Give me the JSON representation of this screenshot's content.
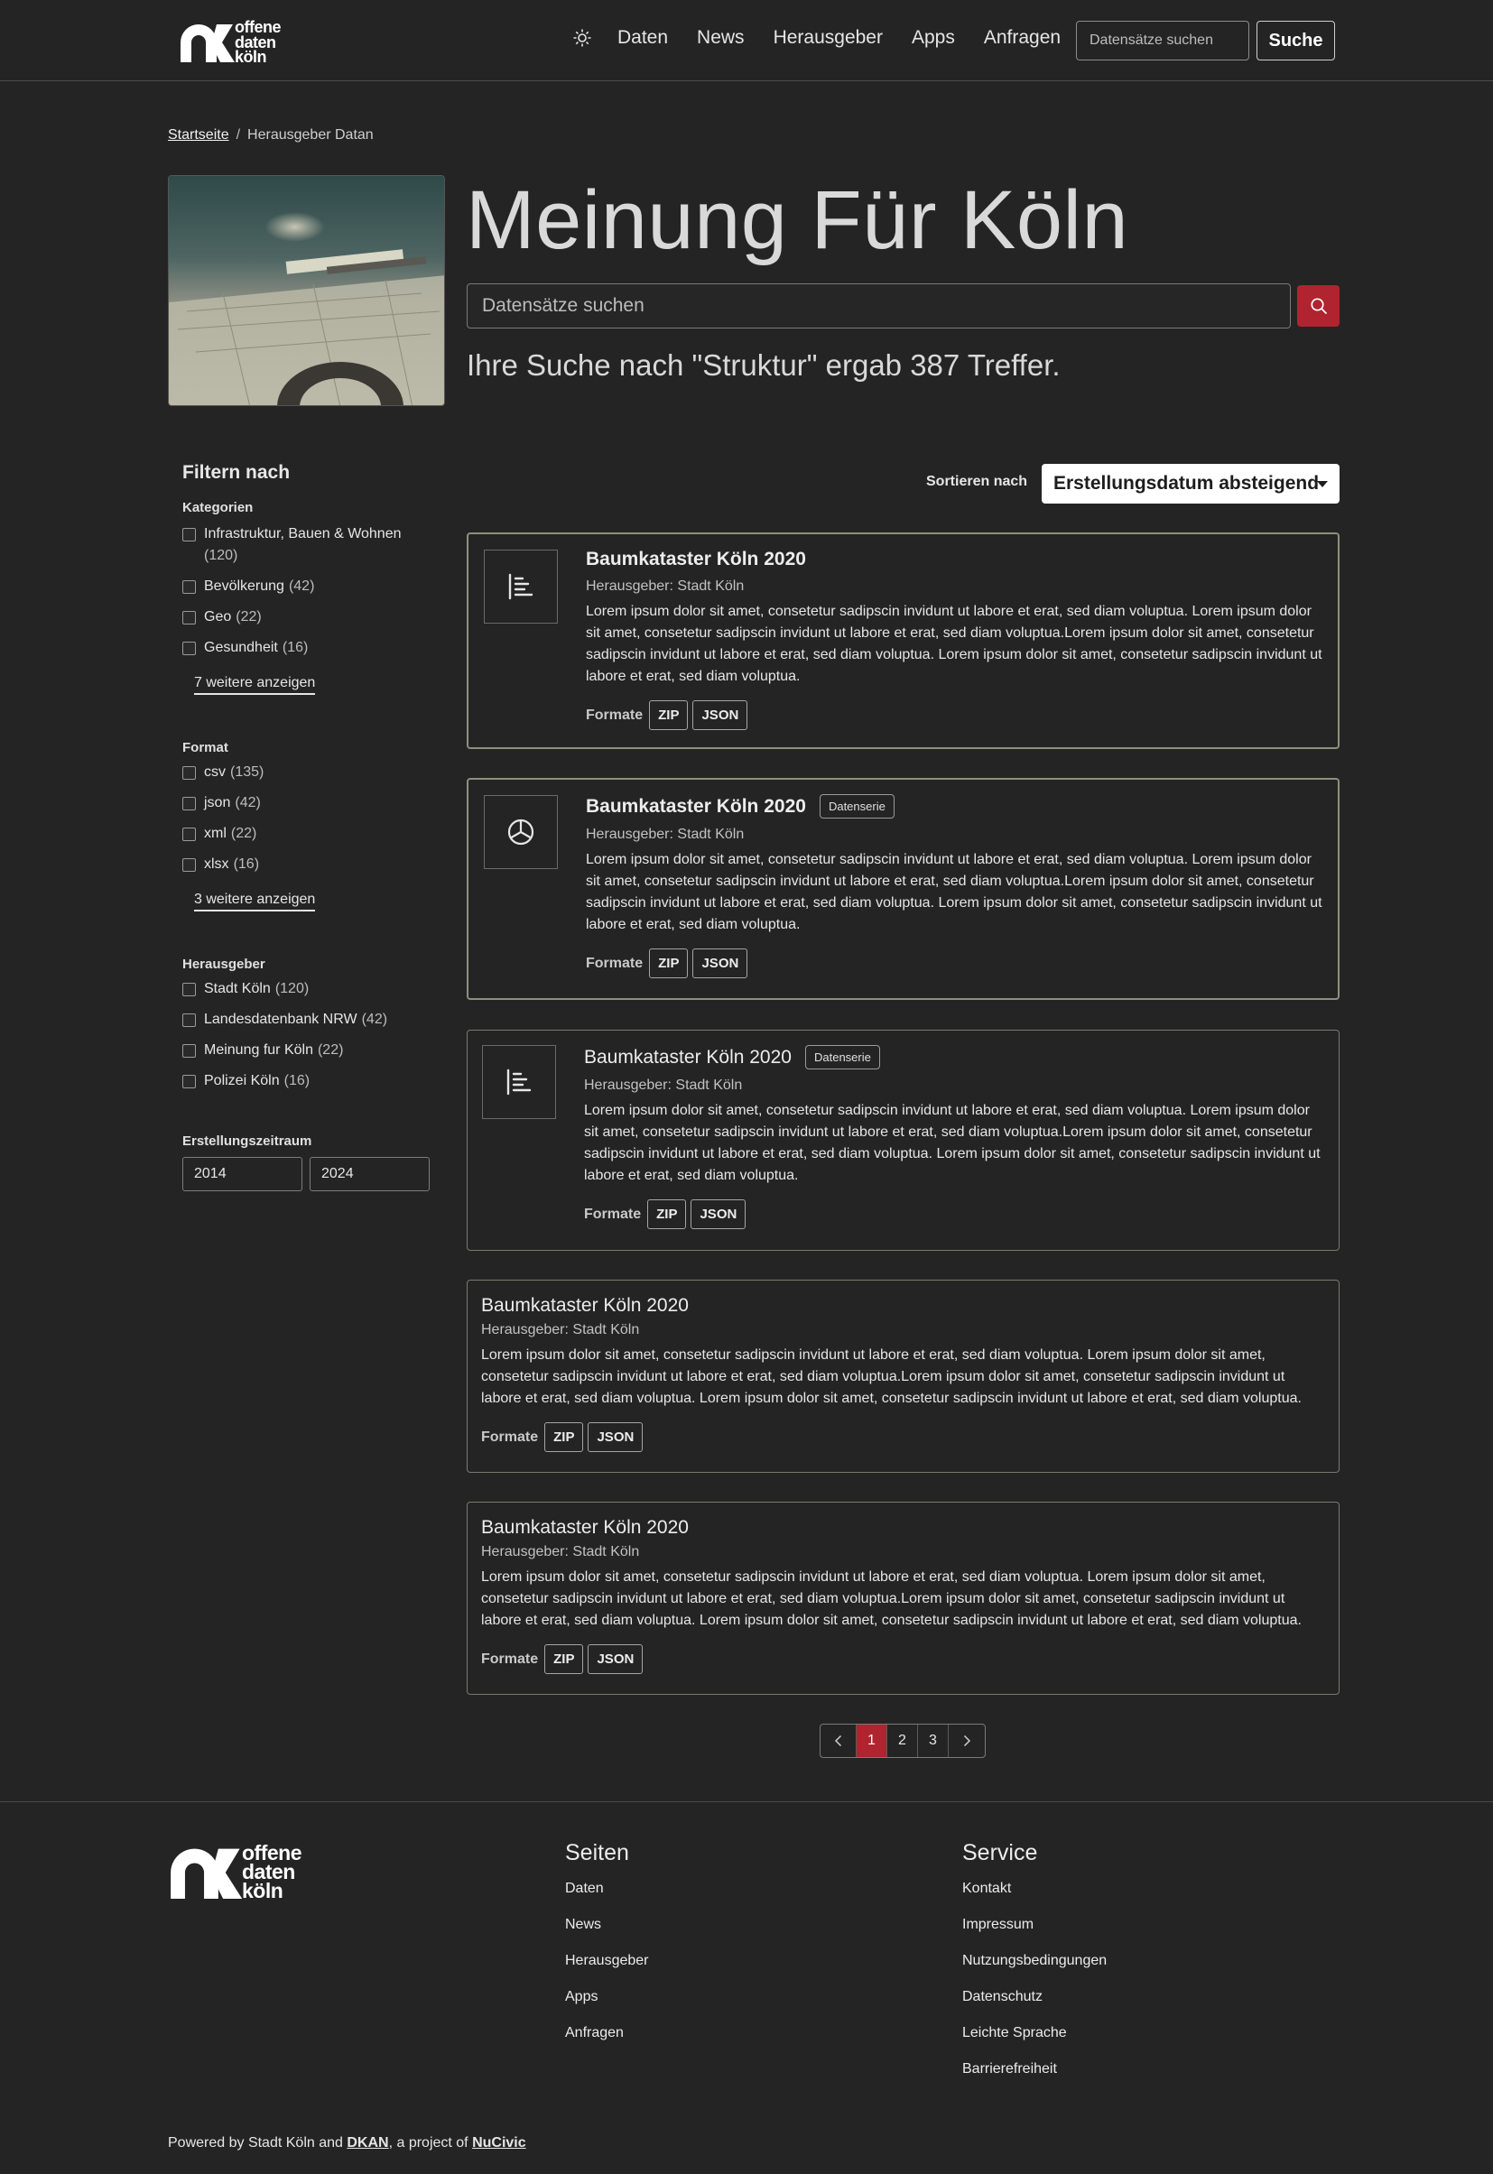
{
  "header": {
    "logo_lines": [
      "offene",
      "daten",
      "köln"
    ],
    "nav": [
      "Daten",
      "News",
      "Herausgeber",
      "Apps",
      "Anfragen"
    ],
    "search_placeholder": "Datensätze suchen",
    "search_button": "Suche"
  },
  "breadcrumb": {
    "home": "Startseite",
    "current": "Herausgeber Datan"
  },
  "hero": {
    "title": "Meinung Für Köln",
    "search_placeholder": "Datensätze suchen",
    "summary": "Ihre Suche nach \"Struktur\" ergab 387 Treffer."
  },
  "sidebar": {
    "title": "Filtern nach",
    "categories": {
      "title": "Kategorien",
      "items": [
        {
          "label": "Infrastruktur, Bauen & Wohnen",
          "count": "(120)"
        },
        {
          "label": "Bevölkerung",
          "count": "(42)"
        },
        {
          "label": "Geo",
          "count": "(22)"
        },
        {
          "label": "Gesundheit",
          "count": "(16)"
        }
      ],
      "more": "7 weitere anzeigen"
    },
    "format": {
      "title": "Format",
      "items": [
        {
          "label": "csv",
          "count": "(135)"
        },
        {
          "label": "json",
          "count": "(42)"
        },
        {
          "label": "xml",
          "count": "(22)"
        },
        {
          "label": "xlsx",
          "count": "(16)"
        }
      ],
      "more": "3 weitere anzeigen"
    },
    "publisher": {
      "title": "Herausgeber",
      "items": [
        {
          "label": "Stadt Köln",
          "count": "(120)"
        },
        {
          "label": "Landesdatenbank NRW",
          "count": "(42)"
        },
        {
          "label": "Meinung fur Köln",
          "count": "(22)"
        },
        {
          "label": "Polizei Köln",
          "count": "(16)"
        }
      ]
    },
    "period": {
      "title": "Erstellungszeitraum",
      "from": "2014",
      "to": "2024"
    }
  },
  "sort": {
    "label": "Sortieren nach",
    "value": "Erstellungsdatum absteigend"
  },
  "results": [
    {
      "icon": "list-icon",
      "title": "Baumkataster Köln 2020",
      "badge": "",
      "publisher": "Herausgeber: Stadt Köln",
      "description": "Lorem ipsum dolor sit amet, consetetur sadipscin invidunt ut labore et erat, sed diam voluptua. Lorem ipsum dolor sit amet, consetetur sadipscin invidunt ut labore et erat, sed diam voluptua.Lorem ipsum dolor sit amet, consetetur sadipscin invidunt ut labore et erat, sed diam voluptua. Lorem ipsum dolor sit amet, consetetur sadipscin invidunt ut labore et erat, sed diam voluptua.",
      "formats_label": "Formate",
      "formats": [
        "ZIP",
        "JSON"
      ]
    },
    {
      "icon": "pie-chart-icon",
      "title": "Baumkataster Köln 2020",
      "badge": "Datenserie",
      "publisher": "Herausgeber: Stadt Köln",
      "description": "Lorem ipsum dolor sit amet, consetetur sadipscin invidunt ut labore et erat, sed diam voluptua. Lorem ipsum dolor sit amet, consetetur sadipscin invidunt ut labore et erat, sed diam voluptua.Lorem ipsum dolor sit amet, consetetur sadipscin invidunt ut labore et erat, sed diam voluptua. Lorem ipsum dolor sit amet, consetetur sadipscin invidunt ut labore et erat, sed diam voluptua.",
      "formats_label": "Formate",
      "formats": [
        "ZIP",
        "JSON"
      ]
    },
    {
      "icon": "list-icon",
      "title": "Baumkataster Köln 2020",
      "badge": "Datenserie",
      "publisher": "Herausgeber: Stadt Köln",
      "description": "Lorem ipsum dolor sit amet, consetetur sadipscin invidunt ut labore et erat, sed diam voluptua. Lorem ipsum dolor sit amet, consetetur sadipscin invidunt ut labore et erat, sed diam voluptua.Lorem ipsum dolor sit amet, consetetur sadipscin invidunt ut labore et erat, sed diam voluptua. Lorem ipsum dolor sit amet, consetetur sadipscin invidunt ut labore et erat, sed diam voluptua.",
      "formats_label": "Formate",
      "formats": [
        "ZIP",
        "JSON"
      ]
    },
    {
      "icon": "",
      "title": "Baumkataster Köln 2020",
      "badge": "",
      "publisher": "Herausgeber: Stadt Köln",
      "description": "Lorem ipsum dolor sit amet, consetetur sadipscin invidunt ut labore et erat, sed diam voluptua. Lorem ipsum dolor sit amet, consetetur sadipscin invidunt ut labore et erat, sed diam voluptua.Lorem ipsum dolor sit amet, consetetur sadipscin invidunt ut labore et erat, sed diam voluptua. Lorem ipsum dolor sit amet, consetetur sadipscin invidunt ut labore et erat, sed diam voluptua.",
      "formats_label": "Formate",
      "formats": [
        "ZIP",
        "JSON"
      ]
    },
    {
      "icon": "",
      "title": "Baumkataster Köln 2020",
      "badge": "",
      "publisher": "Herausgeber: Stadt Köln",
      "description": "Lorem ipsum dolor sit amet, consetetur sadipscin invidunt ut labore et erat, sed diam voluptua. Lorem ipsum dolor sit amet, consetetur sadipscin invidunt ut labore et erat, sed diam voluptua.Lorem ipsum dolor sit amet, consetetur sadipscin invidunt ut labore et erat, sed diam voluptua. Lorem ipsum dolor sit amet, consetetur sadipscin invidunt ut labore et erat, sed diam voluptua.",
      "formats_label": "Formate",
      "formats": [
        "ZIP",
        "JSON"
      ]
    }
  ],
  "pagination": {
    "pages": [
      "1",
      "2",
      "3"
    ],
    "current": "1"
  },
  "footer": {
    "logo_lines": [
      "offene",
      "daten",
      "köln"
    ],
    "pages_title": "Seiten",
    "pages": [
      "Daten",
      "News",
      "Herausgeber",
      "Apps",
      "Anfragen"
    ],
    "service_title": "Service",
    "service": [
      "Kontakt",
      "Impressum",
      "Nutzungsbedingungen",
      "Datenschutz",
      "Leichte Sprache",
      "Barrierefreiheit"
    ],
    "powered_pre": "Powered by Stadt Köln and ",
    "powered_dkan": "DKAN",
    "powered_mid": ", a project of ",
    "powered_nucivic": "NuCivic"
  },
  "colors": {
    "background": "#242424",
    "accent": "#b0242f",
    "text": "#e6e6e6"
  }
}
